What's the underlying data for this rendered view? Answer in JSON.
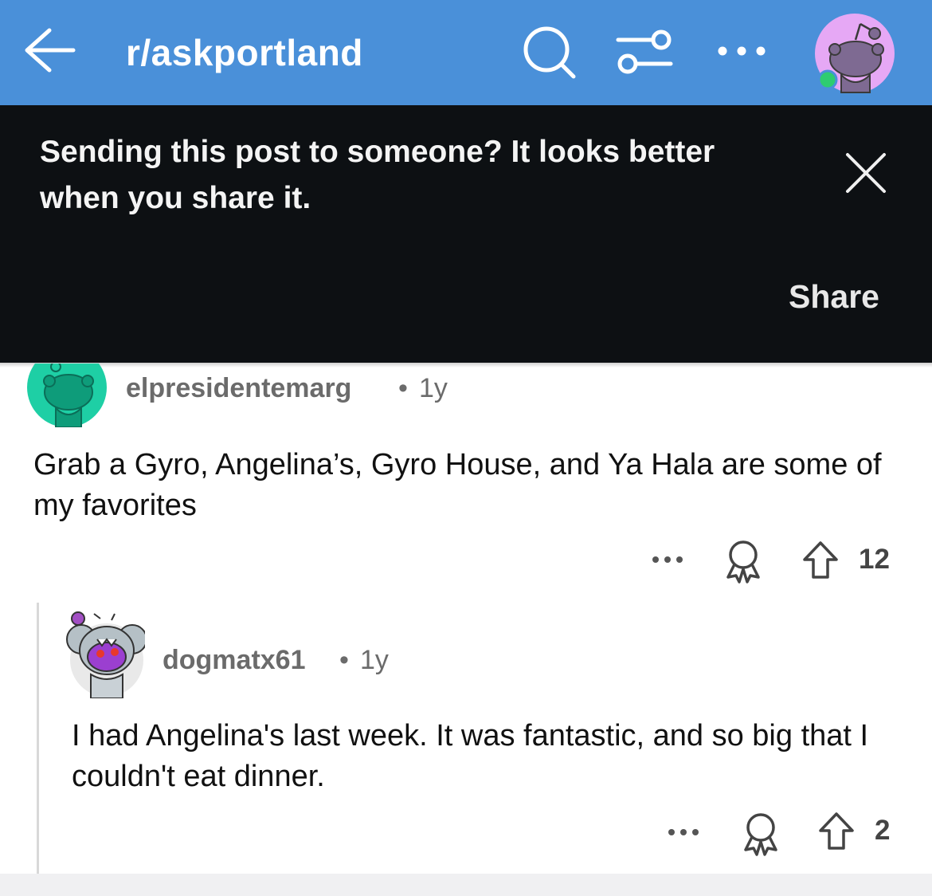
{
  "header": {
    "subreddit": "r/askportland",
    "icons": [
      "back-arrow-icon",
      "search-icon",
      "filter-icon",
      "more-icon",
      "avatar"
    ],
    "online_color": "#2ecc71"
  },
  "banner": {
    "message": "Sending this post to someone? It looks better when you share it.",
    "share_label": "Share"
  },
  "comments": [
    {
      "username": "elpresidentemarg",
      "separator": "•",
      "age": "1y",
      "body": "Grab a Gyro, Angelina’s, Gyro House, and Ya Hala are some of my favorites",
      "votes": "12",
      "avatar_color": "#1ecfa5"
    },
    {
      "username": "dogmatx61",
      "separator": "•",
      "age": "1y",
      "body": "I had Angelina's last week. It was fantastic, and so big that I couldn't eat dinner.",
      "votes": "2"
    }
  ],
  "colors": {
    "header_bg": "#4a90d9",
    "banner_bg": "#0d1013"
  }
}
